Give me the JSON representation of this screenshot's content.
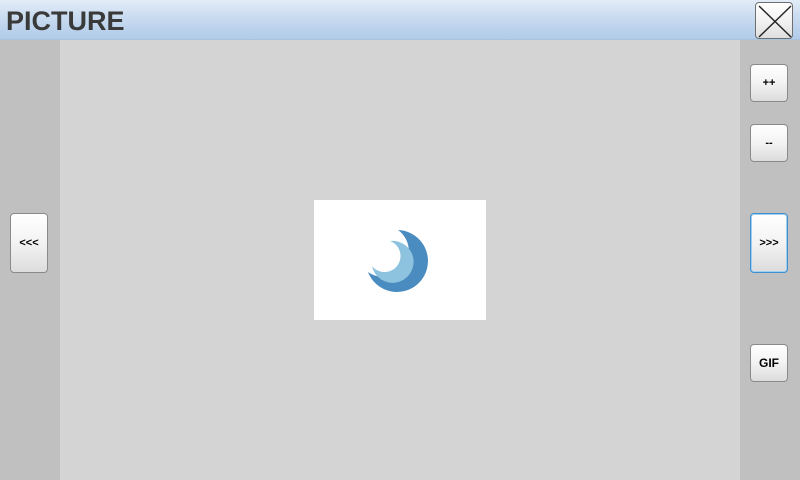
{
  "window": {
    "title": "PICTURE"
  },
  "titlebar": {
    "close_icon": "close-x-icon"
  },
  "controls": {
    "prev_label": "<<<",
    "next_label": ">>>",
    "zoom_in_label": "++",
    "zoom_out_label": "--",
    "gif_label": "GIF"
  },
  "viewer": {
    "image_icon": "crescent-logo-icon"
  },
  "colors": {
    "titlebar_top": "#e3edf8",
    "titlebar_bottom": "#b0cbe9",
    "canvas": "#d4d4d4",
    "side_strip": "#c0c0c0",
    "logo_dark": "#4a8cbf",
    "logo_light": "#8ec3df",
    "focus_border": "#3d8fcf"
  }
}
